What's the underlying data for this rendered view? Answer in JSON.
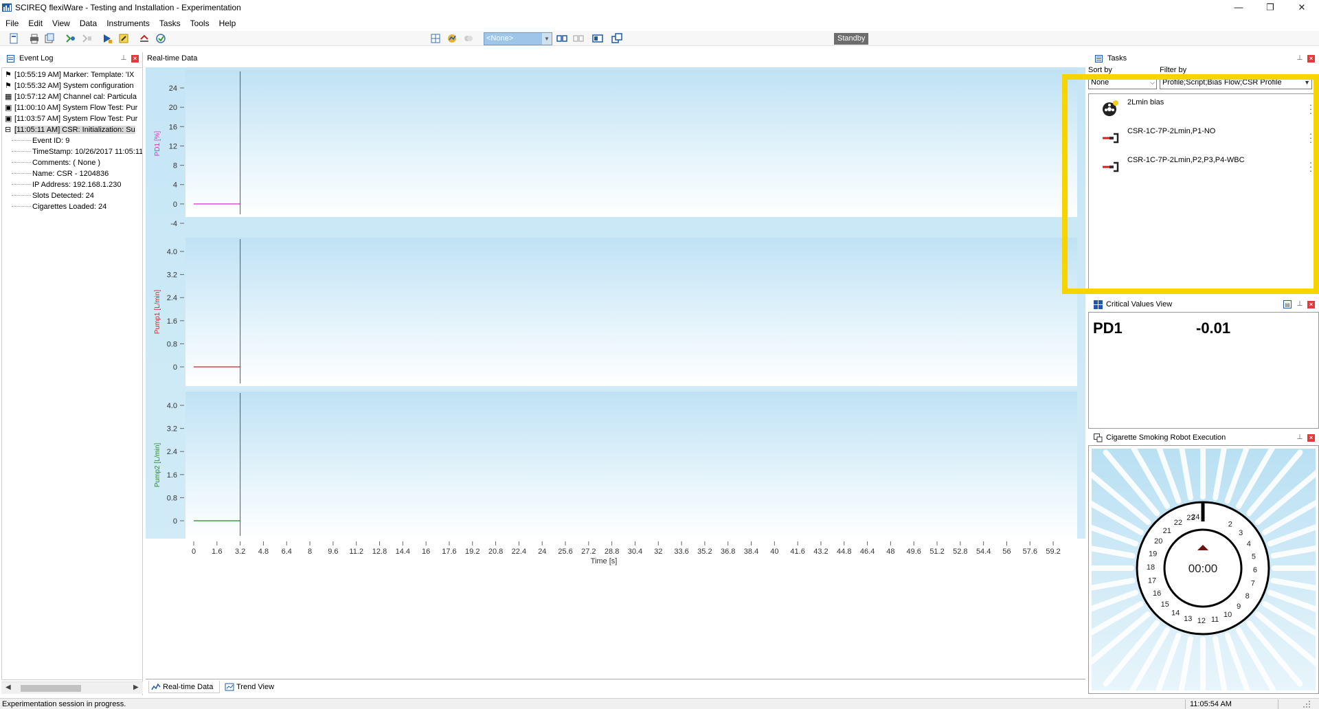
{
  "window": {
    "title": "SCIREQ flexiWare - Testing and Installation - Experimentation",
    "minimize": "—",
    "restore": "❐",
    "close": "✕"
  },
  "menu": [
    "File",
    "Edit",
    "View",
    "Data",
    "Instruments",
    "Tasks",
    "Tools",
    "Help"
  ],
  "toolbar": {
    "profile_value": "<None>",
    "status": "Standby"
  },
  "event_log": {
    "title": "Event Log",
    "entries": [
      {
        "text": "[10:55:19 AM] Marker: Template: 'IX",
        "icon": "flag-icon"
      },
      {
        "text": "[10:55:32 AM] System configuration",
        "icon": "flag-icon"
      },
      {
        "text": "[10:57:12 AM] Channel cal: Particula",
        "icon": "calibration-icon"
      },
      {
        "text": "[11:00:10 AM] System Flow Test: Pur",
        "icon": "flow-test-icon"
      },
      {
        "text": "[11:03:57 AM] System Flow Test: Pur",
        "icon": "flow-test-icon"
      },
      {
        "text": "[11:05:11 AM] CSR: Initialization: Su",
        "icon": "csr-icon"
      }
    ],
    "details": [
      "Event ID: 9",
      "TimeStamp: 10/26/2017 11:05:11",
      "Comments: ( None )",
      "Name: CSR - 1204836",
      "IP Address: 192.168.1.230",
      "Slots Detected: 24",
      "Cigarettes Loaded: 24"
    ]
  },
  "realtime": {
    "title": "Real-time Data",
    "tabs": [
      "Real-time Data",
      "Trend View"
    ]
  },
  "chart_data": {
    "type": "line",
    "xlabel": "Time [s]",
    "x_ticks": [
      "0",
      "1.6",
      "3.2",
      "4.8",
      "6.4",
      "8",
      "9.6",
      "11.2",
      "12.8",
      "14.4",
      "16",
      "17.6",
      "19.2",
      "20.8",
      "22.4",
      "24",
      "25.6",
      "27.2",
      "28.8",
      "30.4",
      "32",
      "33.6",
      "35.2",
      "36.8",
      "38.4",
      "40",
      "41.6",
      "43.2",
      "44.8",
      "46.4",
      "48",
      "49.6",
      "51.2",
      "52.8",
      "54.4",
      "56",
      "57.6",
      "59.2"
    ],
    "xlim": [
      0,
      60
    ],
    "cursor_x": 3.2,
    "grid": false,
    "panels": [
      {
        "ylabel": "PD1 [%]",
        "color": "#cc33cc",
        "y_ticks": [
          "24",
          "20",
          "16",
          "12",
          "8",
          "4",
          "0",
          "-4"
        ],
        "ylim": [
          -5,
          25
        ],
        "series": {
          "x": [
            0,
            3.2
          ],
          "y": [
            0,
            0
          ]
        }
      },
      {
        "ylabel": "Pump1 [L/min]",
        "color": "#cc2222",
        "y_ticks": [
          "4.0",
          "3.2",
          "2.4",
          "1.6",
          "0.8",
          "0"
        ],
        "ylim": [
          -0.5,
          4.5
        ],
        "series": {
          "x": [
            0,
            3.2
          ],
          "y": [
            0,
            0
          ]
        }
      },
      {
        "ylabel": "Pump2 [L/min]",
        "color": "#228822",
        "y_ticks": [
          "4.0",
          "3.2",
          "2.4",
          "1.6",
          "0.8",
          "0"
        ],
        "ylim": [
          -0.5,
          4.5
        ],
        "series": {
          "x": [
            0,
            3.2
          ],
          "y": [
            0,
            0
          ]
        }
      }
    ]
  },
  "tasks": {
    "title": "Tasks",
    "sort_by_label": "Sort by",
    "sort_by_value": "None",
    "filter_by_label": "Filter by",
    "filter_by_value": "Profile;Script;Bias Flow;CSR Profile",
    "items": [
      {
        "label": "2Lmin bias",
        "icon": "bias-flow-icon"
      },
      {
        "label": "CSR-1C-7P-2Lmin,P1-NO",
        "icon": "csr-profile-icon"
      },
      {
        "label": "CSR-1C-7P-2Lmin,P2,P3,P4-WBC",
        "icon": "csr-profile-icon"
      }
    ],
    "highlight_color": "#f5d400"
  },
  "critical_values": {
    "title": "Critical Values View",
    "name": "PD1",
    "value": "-0.01"
  },
  "csr_execution": {
    "title": "Cigarette Smoking Robot Execution",
    "timer": "00:00",
    "slots": [
      "24",
      "2",
      "3",
      "4",
      "5",
      "6",
      "7",
      "8",
      "9",
      "10",
      "11",
      "12",
      "13",
      "14",
      "15",
      "16",
      "17",
      "18",
      "19",
      "20",
      "21",
      "22",
      "23"
    ]
  },
  "status_bar": {
    "message": "Experimentation session in progress.",
    "time": "11:05:54 AM"
  }
}
